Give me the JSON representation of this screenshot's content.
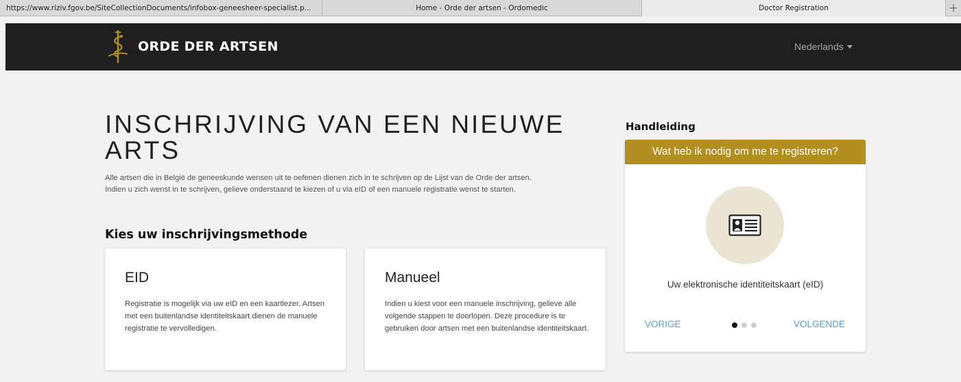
{
  "browser": {
    "tabs": [
      {
        "label": "https://www.riziv.fgov.be/SiteCollectionDocuments/infobox-geneesheer-specialist.p..."
      },
      {
        "label": "Home - Orde der artsen - Ordomedic"
      },
      {
        "label": "Doctor Registration",
        "active": true
      }
    ],
    "new_tab_symbol": "+"
  },
  "navbar": {
    "brand_text": "ORDE DER ARTSEN",
    "logo_icon": "caduceus-icon",
    "language": "Nederlands",
    "brand_color": "#b38f20",
    "background": "#1f1f1f"
  },
  "main": {
    "title": "INSCHRIJVING VAN EEN NIEUWE ARTS",
    "intro_line1": "Alle artsen die in België de geneeskunde wensen uit te oefenen dienen zich in te schrijven op de Lijst van de Orde der artsen.",
    "intro_line2": "Indien u zich wenst in te schrijven, gelieve onderstaand te kiezen of u via eID of een manuele registratie wenst te starten.",
    "method_heading": "Kies uw inschrijvingsmethode",
    "cards": [
      {
        "title": "EID",
        "text": "Registratie is mogelijk via uw eID en een kaartlezer. Artsen met een buitenlandse identiteitskaart dienen de manuele registratie te vervolledigen."
      },
      {
        "title": "Manueel",
        "text": "Indien u kiest voor een manuele inschrijving, gelieve alle volgende stappen te doorlopen. Deze procedure is te gebruiken door artsen met een buitenlandse identiteitskaart."
      }
    ]
  },
  "guide": {
    "heading": "Handleiding",
    "header": "Wat heb ik nodig om me te registreren?",
    "icon": "id-card-icon",
    "caption": "Uw elektronische identiteitskaart (eID)",
    "prev_label": "VORIGE",
    "next_label": "VOLGENDE",
    "slide_count": 3,
    "active_slide": 1,
    "accent_color": "#b38f20",
    "link_color": "#4f9fd8"
  }
}
